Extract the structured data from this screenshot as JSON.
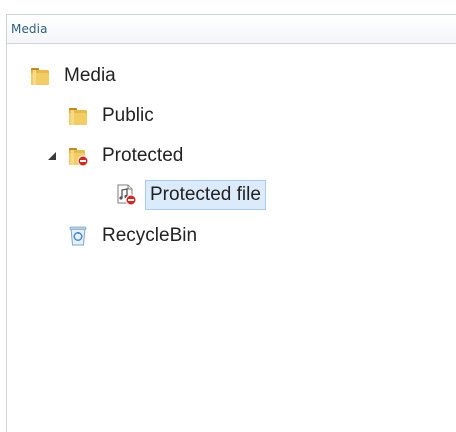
{
  "panel": {
    "title": "Media"
  },
  "tree": {
    "items": [
      {
        "label": "Media",
        "icon": "folder-icon",
        "expanded": true
      },
      {
        "label": "Public",
        "icon": "folder-icon"
      },
      {
        "label": "Protected",
        "icon": "protected-folder-icon",
        "expanded": true
      },
      {
        "label": "Protected file",
        "icon": "protected-file-icon",
        "selected": true
      },
      {
        "label": "RecycleBin",
        "icon": "recycle-bin-icon"
      }
    ]
  },
  "colors": {
    "folder": "#e9b949",
    "folder_dark": "#c08a1f",
    "selection_bg": "#dcebfb",
    "selection_border": "#a9cdef",
    "header_text": "#2f5f86",
    "protected_badge": "#d9261c"
  }
}
